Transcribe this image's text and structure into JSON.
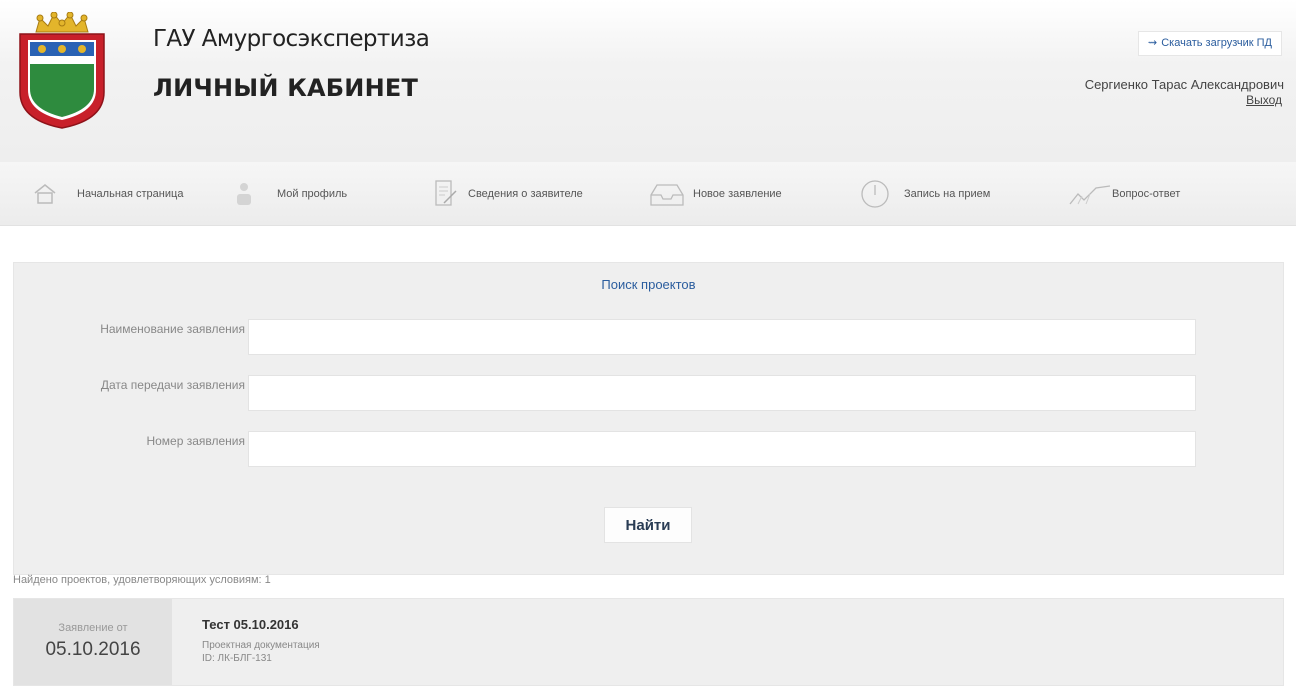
{
  "header": {
    "org_title": "ГАУ Амургосэкспертиза",
    "cabinet_title": "ЛИЧНЫЙ КАБИНЕТ",
    "download_label": "Скачать загрузчик ПД",
    "user_name": "Сергиенко Тарас Александрович",
    "logout_label": "Выход"
  },
  "nav": {
    "items": [
      {
        "label": "Начальная страница",
        "icon": "home-icon"
      },
      {
        "label": "Мой профиль",
        "icon": "user-icon"
      },
      {
        "label": "Сведения о заявителе",
        "icon": "edit-document-icon"
      },
      {
        "label": "Новое заявление",
        "icon": "inbox-icon"
      },
      {
        "label": "Запись на прием",
        "icon": "clock-icon"
      },
      {
        "label": "Вопрос-ответ",
        "icon": "chart-icon"
      }
    ]
  },
  "search": {
    "title": "Поиск проектов",
    "fields": [
      {
        "label": "Наименование заявления",
        "value": ""
      },
      {
        "label": "Дата передачи заявления",
        "value": ""
      },
      {
        "label": "Номер заявления",
        "value": ""
      }
    ],
    "button_label": "Найти"
  },
  "results": {
    "found_text": "Найдено проектов, удовлетворяющих условиям: 1",
    "items": [
      {
        "date_label": "Заявление от",
        "date": "05.10.2016",
        "title": "Тест 05.10.2016",
        "subtitle": "Проектная документация",
        "id": "ID: ЛК-БЛГ-131"
      }
    ]
  },
  "colors": {
    "accent": "#2b5d9e",
    "coat_red": "#c8202a",
    "coat_green": "#2e8b3e",
    "coat_gold": "#e3b52b"
  }
}
